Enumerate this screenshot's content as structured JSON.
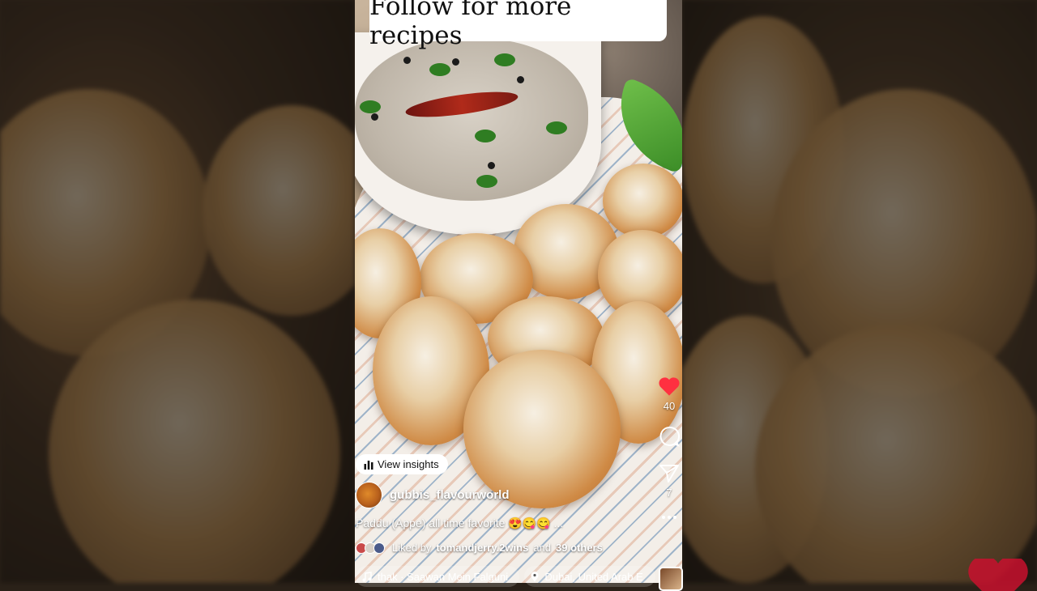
{
  "banner": {
    "text": "Follow for more recipes"
  },
  "actions": {
    "like_count": "40",
    "share_count": "7",
    "colors": {
      "like": "#ff3040",
      "icon": "#ffffff"
    }
  },
  "insights": {
    "label": "View insights"
  },
  "post": {
    "username": "gubbis_flavourworld",
    "caption": "Paddu (Appe) all time favorite 😍😋😋 ...",
    "likes_prefix": "Liked by",
    "likes_user": "tomandjerry.2wins",
    "likes_and": "and",
    "likes_others": "39 others"
  },
  "bottom": {
    "music": "thak · Saawan Mein  Falguni",
    "location": "Dubai, United Arab E"
  },
  "icons": [
    "heart-icon",
    "comment-icon",
    "share-icon",
    "more-icon",
    "bar-chart-icon",
    "music-note-icon",
    "location-pin-icon"
  ]
}
